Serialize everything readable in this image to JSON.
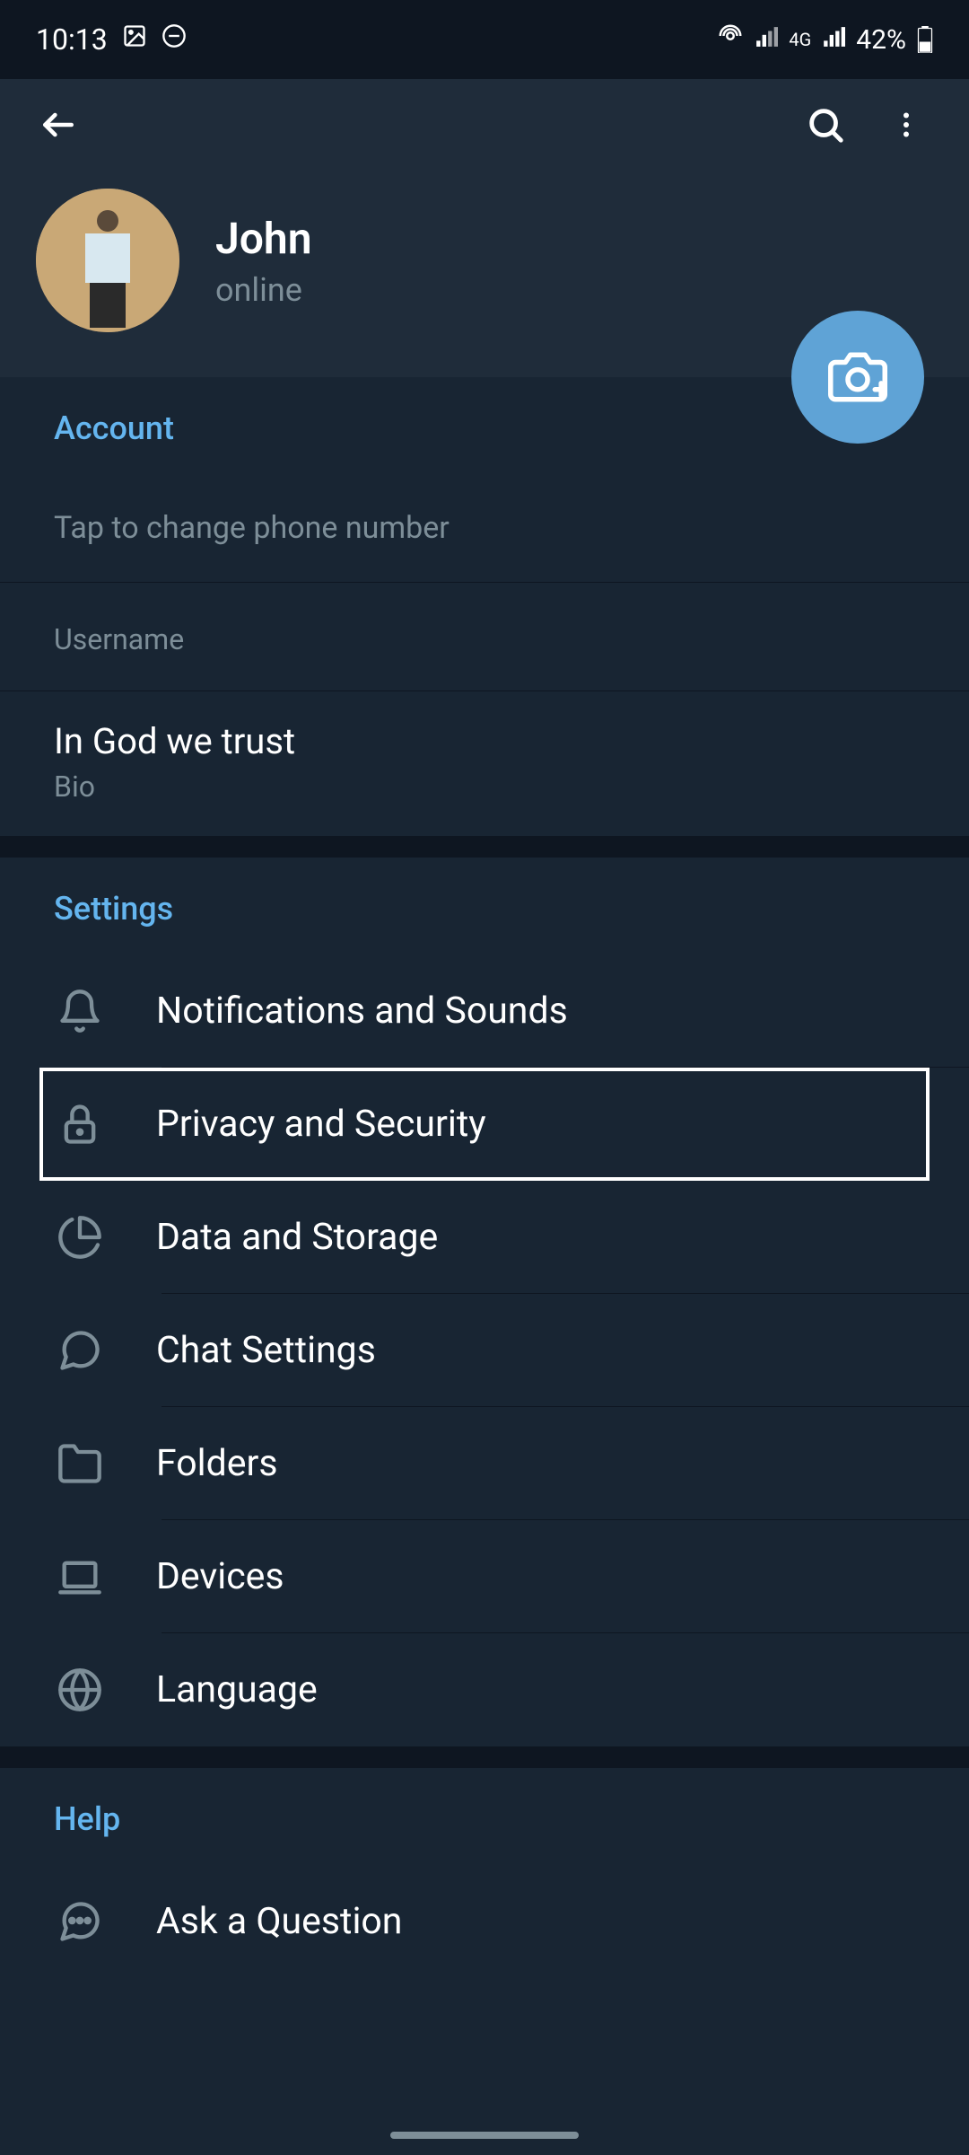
{
  "statusBar": {
    "time": "10:13",
    "battery": "42%",
    "network": "4G"
  },
  "profile": {
    "name": "John",
    "status": "online"
  },
  "sections": {
    "account": {
      "title": "Account",
      "phoneHint": "Tap to change phone number",
      "usernameLabel": "Username",
      "bio": "In God we trust",
      "bioLabel": "Bio"
    },
    "settings": {
      "title": "Settings",
      "items": [
        {
          "label": "Notifications and Sounds",
          "icon": "bell"
        },
        {
          "label": "Privacy and Security",
          "icon": "lock"
        },
        {
          "label": "Data and Storage",
          "icon": "pie"
        },
        {
          "label": "Chat Settings",
          "icon": "chat"
        },
        {
          "label": "Folders",
          "icon": "folder"
        },
        {
          "label": "Devices",
          "icon": "laptop"
        },
        {
          "label": "Language",
          "icon": "globe"
        }
      ]
    },
    "help": {
      "title": "Help",
      "items": [
        {
          "label": "Ask a Question",
          "icon": "question"
        }
      ]
    }
  }
}
